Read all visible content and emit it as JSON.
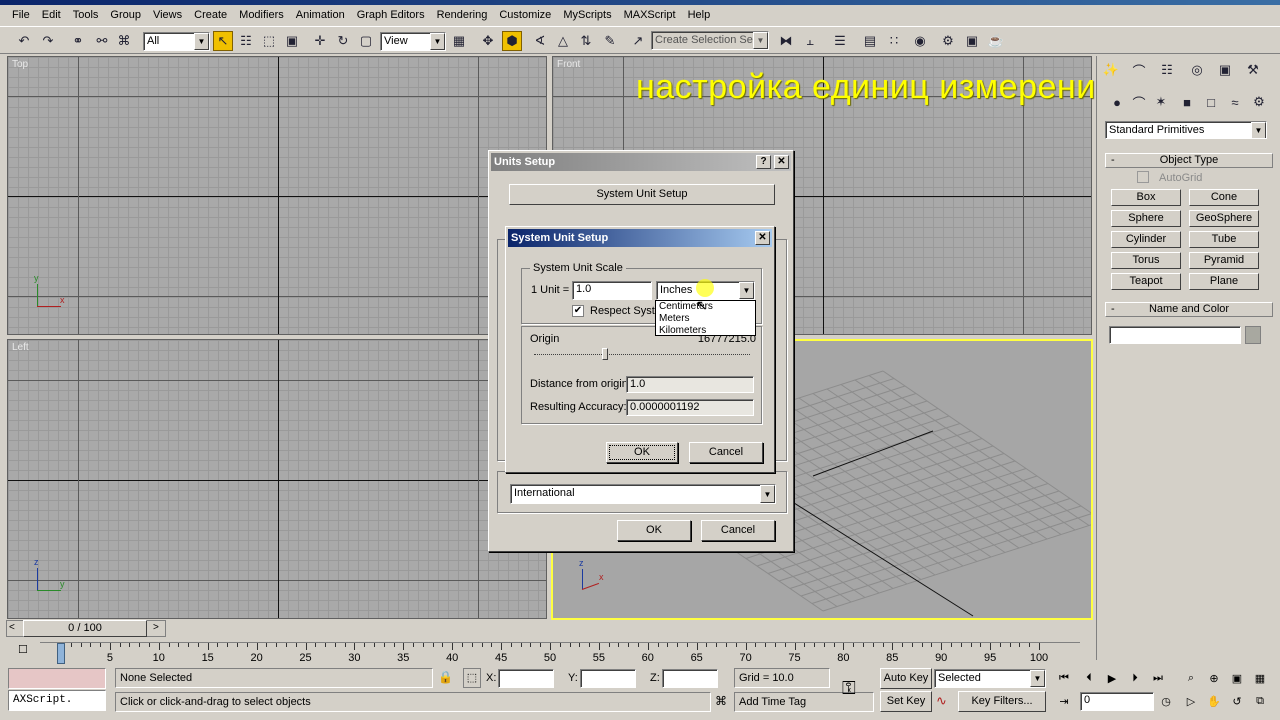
{
  "menu": [
    "File",
    "Edit",
    "Tools",
    "Group",
    "Views",
    "Create",
    "Modifiers",
    "Animation",
    "Graph Editors",
    "Rendering",
    "Customize",
    "MyScripts",
    "MAXScript",
    "Help"
  ],
  "toolbar": {
    "selection_filter": "All",
    "reference_coord": "View",
    "named_selection_placeholder": "Create Selection Set"
  },
  "viewports": {
    "top": "Top",
    "front": "Front",
    "left": "Left",
    "perspective": ""
  },
  "overlay_caption": "настройка единиц измерения",
  "command_panel": {
    "category": "Standard Primitives",
    "object_type_title": "Object Type",
    "autogrid_label": "AutoGrid",
    "primitives": [
      "Box",
      "Cone",
      "Sphere",
      "GeoSphere",
      "Cylinder",
      "Tube",
      "Torus",
      "Pyramid",
      "Teapot",
      "Plane"
    ],
    "name_color_title": "Name and Color",
    "name_value": ""
  },
  "units_setup": {
    "title": "Units Setup",
    "system_unit_button": "System Unit Setup",
    "display_scale_value": "International",
    "ok": "OK",
    "cancel": "Cancel"
  },
  "system_unit_setup": {
    "title": "System Unit Setup",
    "scale_group": "System Unit Scale",
    "unit_label": "1 Unit =",
    "unit_value": "1.0",
    "unit_selected": "Inches",
    "unit_options": [
      "Centimeters",
      "Meters",
      "Kilometers"
    ],
    "respect_label": "Respect System Units in Files",
    "origin_label": "Origin",
    "origin_value": "16777215.0",
    "distance_label": "Distance from origin:",
    "distance_value": "1.0",
    "accuracy_label": "Resulting Accuracy:",
    "accuracy_value": "0.0000001192",
    "ok": "OK",
    "cancel": "Cancel"
  },
  "timeline": {
    "frame_display": "0 / 100",
    "ticks": [
      "0",
      "5",
      "10",
      "15",
      "20",
      "25",
      "30",
      "35",
      "40",
      "45",
      "50",
      "55",
      "60",
      "65",
      "70",
      "75",
      "80",
      "85",
      "90",
      "95",
      "100"
    ]
  },
  "status": {
    "maxscript": "AXScript.",
    "selection": "None Selected",
    "prompt": "Click or click-and-drag to select objects",
    "x_label": "X:",
    "y_label": "Y:",
    "z_label": "Z:",
    "grid": "Grid = 10.0",
    "add_time_tag": "Add Time Tag",
    "auto_key": "Auto Key",
    "set_key": "Set Key",
    "key_mode": "Selected",
    "key_filters": "Key Filters...",
    "current_frame": "0"
  },
  "colors": {
    "title_active": "#0a246a",
    "title_gradient": "#a6caf0",
    "overlay": "#ffff00",
    "persp_border": "#ffff40"
  }
}
